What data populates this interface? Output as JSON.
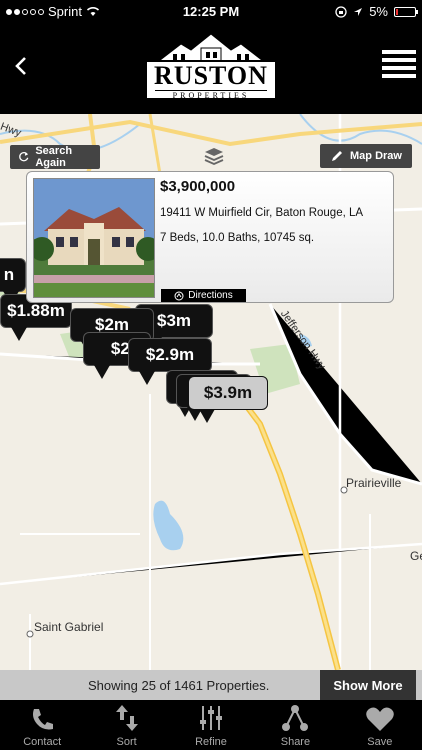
{
  "status_bar": {
    "carrier": "Sprint",
    "time": "12:25 PM",
    "battery": "5%"
  },
  "header": {
    "logo_main": "RUSTON",
    "logo_sub": "PROPERTIES"
  },
  "map": {
    "search_again_label": "Search Again",
    "map_draw_label": "Map Draw",
    "labels": {
      "prairieville": "Prairieville",
      "saint_gabriel": "Saint Gabriel",
      "jefferson_hwy": "Jefferson Hwy",
      "ge_partial": "Ge",
      "hwy_top": "Hwy"
    },
    "pins": {
      "p1": "n",
      "p2": "$1.88m",
      "p3": "$2m",
      "p4": "$3m",
      "p5": "$2.3",
      "p6": "$2.9m",
      "p7": "$3.9m"
    }
  },
  "listing_popup": {
    "price": "$3,900,000",
    "address": "19411 W Muirfield Cir, Baton Rouge, LA",
    "details": "7 Beds, 10.0 Baths, 10745 sq.",
    "directions_label": "Directions"
  },
  "results_bar": {
    "showing_text": "Showing 25 of 1461 Properties.",
    "show_more_label": "Show More"
  },
  "tabbar": {
    "contact": "Contact",
    "sort": "Sort",
    "refine": "Refine",
    "share": "Share",
    "save": "Save"
  }
}
